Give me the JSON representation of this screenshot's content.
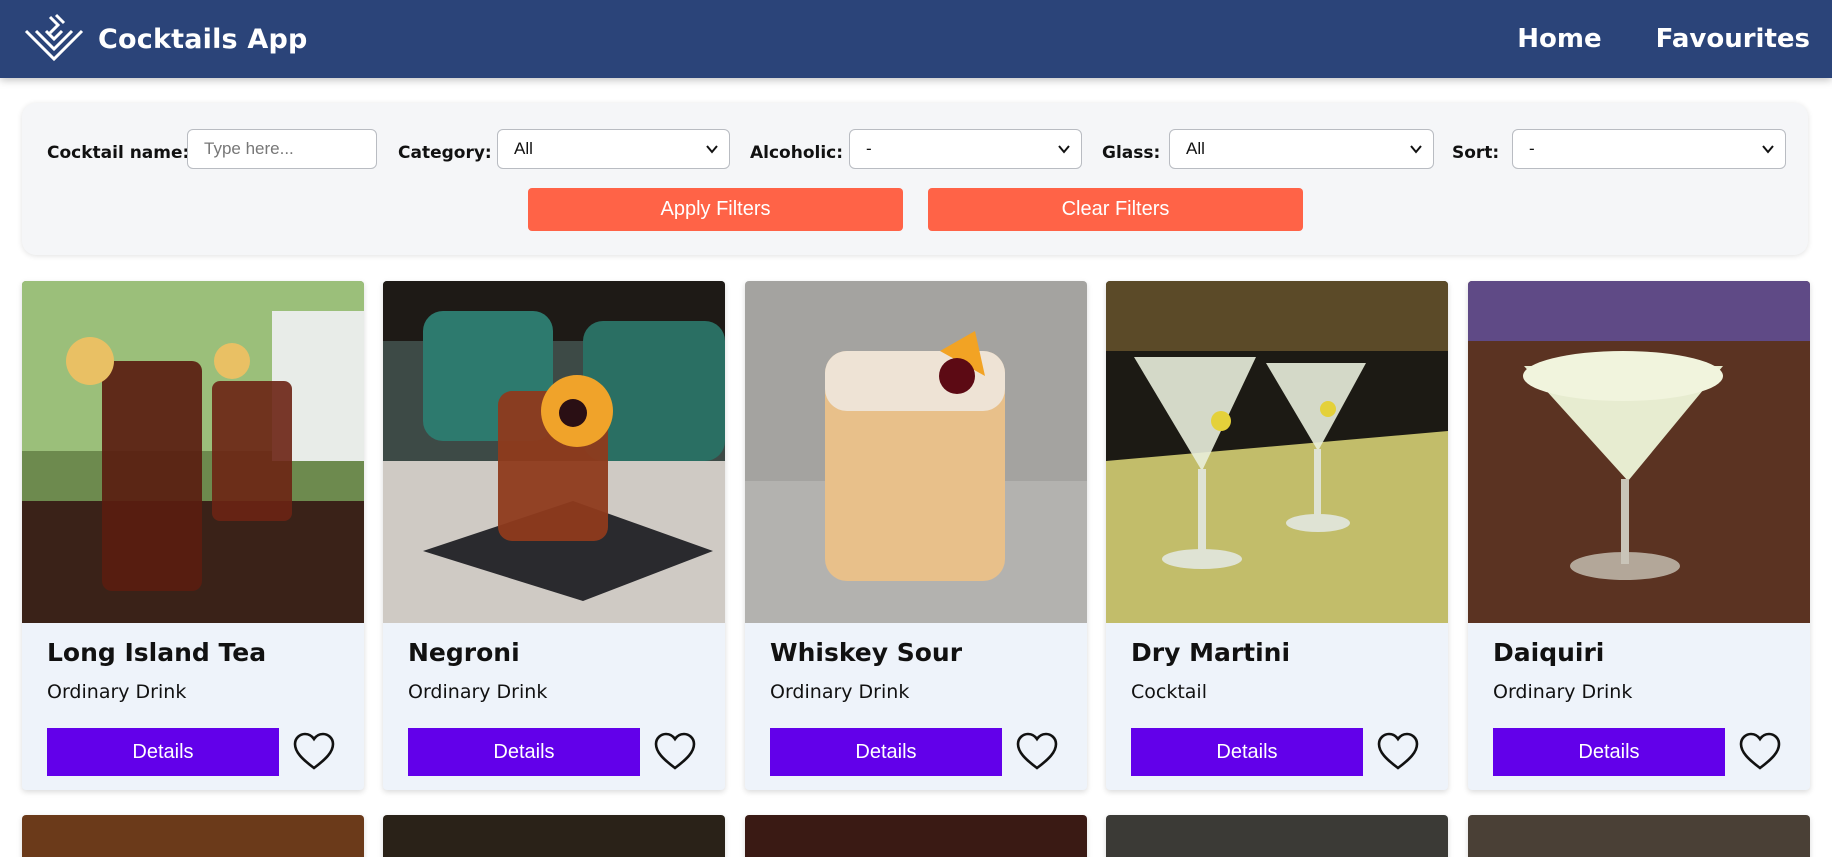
{
  "header": {
    "title": "Cocktails App",
    "nav": [
      "Home",
      "Favourites"
    ]
  },
  "filters": {
    "name_label": "Cocktail name:",
    "name_placeholder": "Type here...",
    "category_label": "Category:",
    "category_value": "All",
    "alcoholic_label": "Alcoholic:",
    "alcoholic_value": "-",
    "glass_label": "Glass:",
    "glass_value": "All",
    "sort_label": "Sort:",
    "sort_value": "-",
    "apply_label": "Apply Filters",
    "clear_label": "Clear Filters"
  },
  "cards": [
    {
      "name": "Long Island Tea",
      "category": "Ordinary Drink",
      "details_label": "Details"
    },
    {
      "name": "Negroni",
      "category": "Ordinary Drink",
      "details_label": "Details"
    },
    {
      "name": "Whiskey Sour",
      "category": "Ordinary Drink",
      "details_label": "Details"
    },
    {
      "name": "Dry Martini",
      "category": "Cocktail",
      "details_label": "Details"
    },
    {
      "name": "Daiquiri",
      "category": "Ordinary Drink",
      "details_label": "Details"
    }
  ],
  "colors": {
    "header": "#2b4479",
    "accent_button": "#ff6347",
    "details_button": "#6200ea",
    "card_bg": "#eef3fa"
  }
}
